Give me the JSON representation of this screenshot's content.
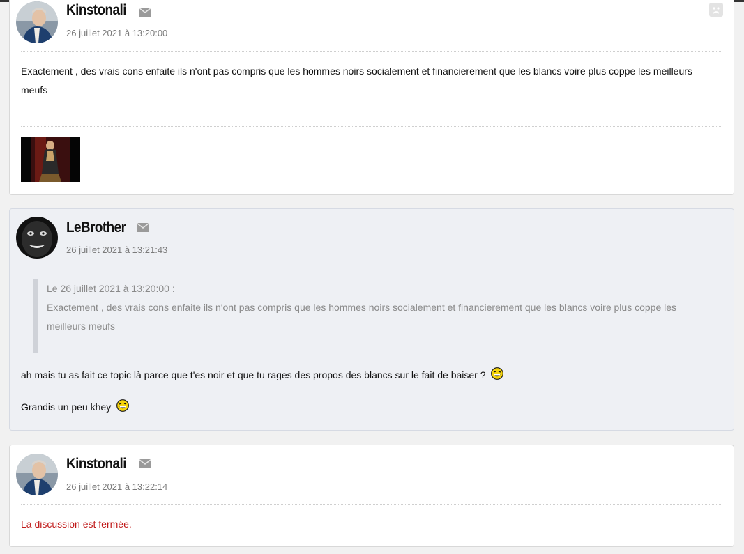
{
  "posts": [
    {
      "author": "Kinstonali",
      "date": "26 juillet 2021 à 13:20:00",
      "text": "Exactement , des vrais cons enfaite ils n'ont pas compris que les hommes noirs socialement et financierement que les blancs voire plus coppe les meilleurs meufs",
      "signature_image": "painting-thumbnail"
    },
    {
      "author": "LeBrother",
      "date": "26 juillet 2021 à 13:21:43",
      "quote_header": "Le 26 juillet 2021 à 13:20:00 :",
      "quote_text": "Exactement , des vrais cons enfaite ils n'ont pas compris que les hommes noirs socialement et financierement que les blancs voire plus coppe les meilleurs meufs",
      "line1": "ah mais tu as fait ce topic là parce que t'es noir et que tu rages des propos des blancs sur le fait de baiser ?",
      "line2": "Grandis un peu khey"
    },
    {
      "author": "Kinstonali",
      "date": "26 juillet 2021 à 13:22:14",
      "text": "La discussion est fermée."
    }
  ],
  "colors": {
    "closed_notice": "#c01818",
    "alt_post_bg": "#eef0f4"
  }
}
